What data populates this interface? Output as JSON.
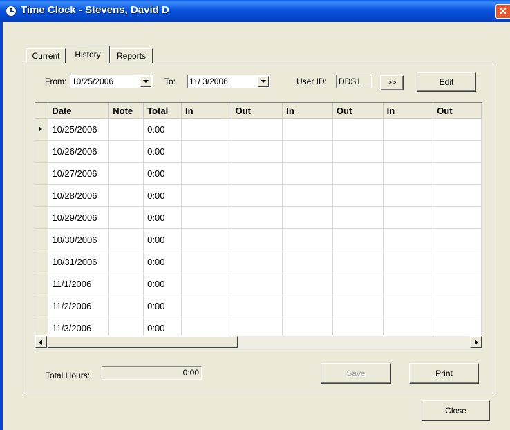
{
  "window": {
    "title": "Time Clock - Stevens, David D",
    "close_glyph": "✕"
  },
  "tabs": [
    {
      "label": "Current",
      "active": false
    },
    {
      "label": "History",
      "active": true
    },
    {
      "label": "Reports",
      "active": false
    }
  ],
  "filters": {
    "from_label": "From:",
    "from_value": "10/25/2006",
    "to_label": "To:",
    "to_value": "11/ 3/2006",
    "user_id_label": "User ID:",
    "user_id_value": "DDS1",
    "next_label": ">>",
    "edit_label": "Edit"
  },
  "grid": {
    "columns": [
      "Date",
      "Note",
      "Total",
      "In",
      "Out",
      "In",
      "Out",
      "In",
      "Out"
    ],
    "rows": [
      {
        "date": "10/25/2006",
        "note": "",
        "total": "0:00",
        "selected": true
      },
      {
        "date": "10/26/2006",
        "note": "",
        "total": "0:00"
      },
      {
        "date": "10/27/2006",
        "note": "",
        "total": "0:00"
      },
      {
        "date": "10/28/2006",
        "note": "",
        "total": "0:00"
      },
      {
        "date": "10/29/2006",
        "note": "",
        "total": "0:00"
      },
      {
        "date": "10/30/2006",
        "note": "",
        "total": "0:00"
      },
      {
        "date": "10/31/2006",
        "note": "",
        "total": "0:00"
      },
      {
        "date": "11/1/2006",
        "note": "",
        "total": "0:00"
      },
      {
        "date": "11/2/2006",
        "note": "",
        "total": "0:00"
      },
      {
        "date": "11/3/2006",
        "note": "",
        "total": "0:00"
      }
    ]
  },
  "footer": {
    "total_hours_label": "Total Hours:",
    "total_hours_value": "0:00",
    "save_label": "Save",
    "print_label": "Print",
    "close_label": "Close"
  },
  "colors": {
    "titlebar": "#0A5FE8",
    "dialog_bg": "#ECE9D8",
    "close_button": "#E2572E"
  }
}
